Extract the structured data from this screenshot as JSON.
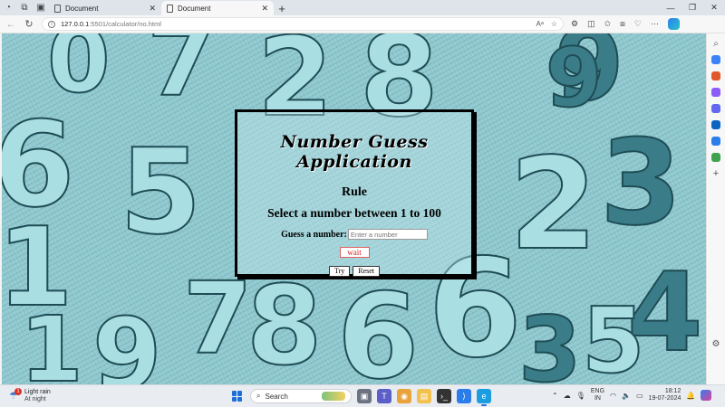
{
  "browser": {
    "tabs": [
      {
        "label": "Document",
        "active": false
      },
      {
        "label": "Document",
        "active": true
      }
    ],
    "new_tab_glyph": "+",
    "window_controls": [
      "—",
      "❐",
      "✕"
    ],
    "address": {
      "host": "127.0.0.1",
      "path": ":5501/calculator/no.html"
    },
    "icons": [
      "back-icon",
      "refresh-icon",
      "read-aloud-icon",
      "favorite-icon",
      "extensions-icon",
      "split-screen-icon",
      "favorites-icon",
      "collections-icon",
      "browser-essentials-icon",
      "more-icon",
      "copilot-icon"
    ]
  },
  "page": {
    "title": "Number Guess Application",
    "rule_heading": "Rule",
    "rule_text": "Select a number between 1 to 100",
    "guess_label": "Guess a number:",
    "guess_placeholder": "Enter a number",
    "status": "wait",
    "try_label": "Try",
    "reset_label": "Reset",
    "background_digits": [
      "2",
      "8",
      "9",
      "6",
      "5",
      "2",
      "3",
      "0",
      "7",
      "1",
      "4",
      "6",
      "8",
      "9",
      "3",
      "7",
      "1",
      "6",
      "5",
      "9"
    ]
  },
  "taskbar": {
    "weather_condition": "Light rain",
    "weather_time": "At night",
    "weather_badge": "1",
    "search_placeholder": "Search",
    "language": "ENG",
    "region": "IN",
    "time": "18:12",
    "date": "19-07-2024"
  },
  "colors": {
    "accent": "#1f6fd8",
    "status_text": "#d02020",
    "background": "#8fc9cf"
  }
}
